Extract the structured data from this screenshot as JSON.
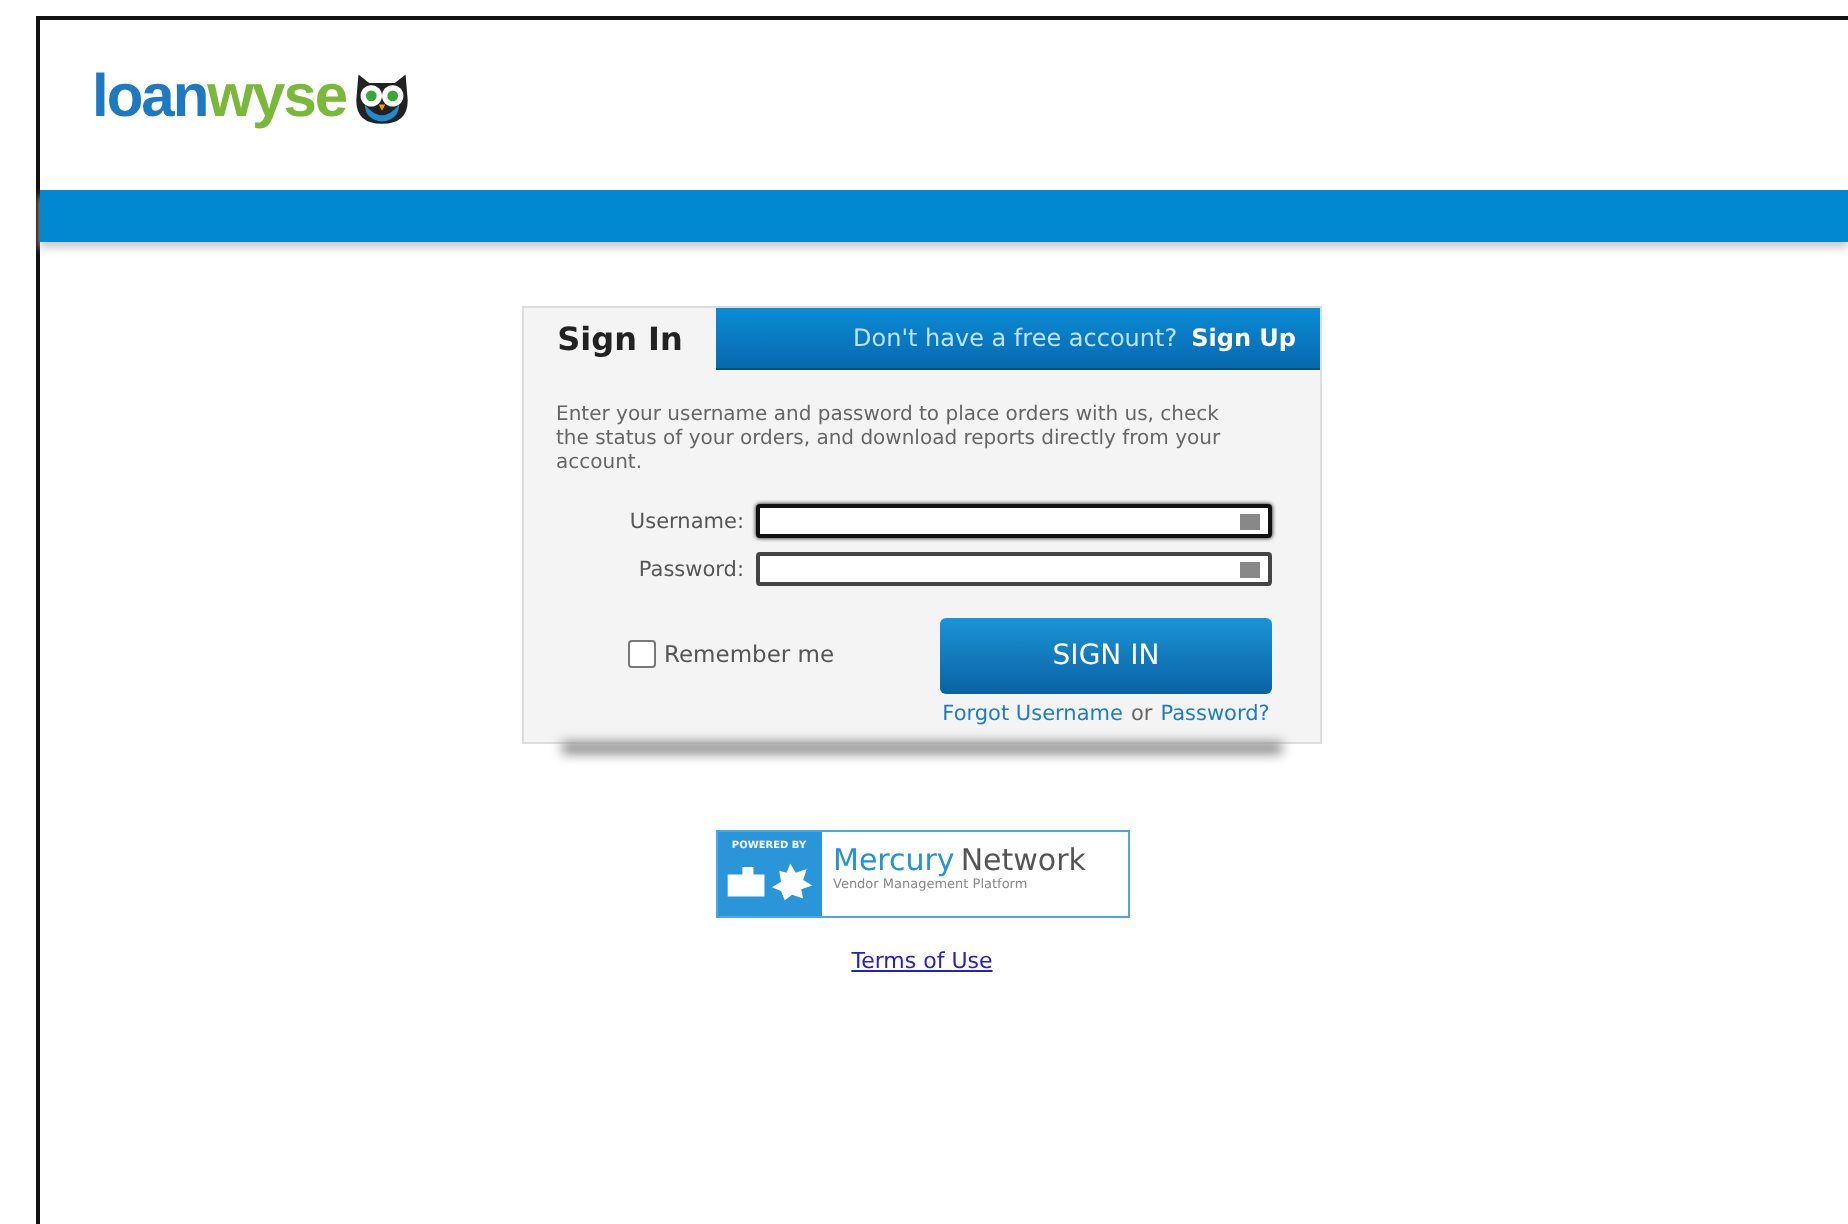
{
  "logo": {
    "first": "loan",
    "second": "wyse"
  },
  "signin": {
    "tabs": [
      {
        "label": "Sign In",
        "selected": true
      }
    ],
    "signup_prompt": "Don't have a free account?",
    "signup_link": "Sign Up",
    "intro": "Enter your username and password to place orders with us, check the status of your orders, and download reports directly from your account.",
    "fields": [
      {
        "label": "Username:",
        "focused": true
      },
      {
        "label": "Password:",
        "focused": false
      }
    ],
    "remember": {
      "label": "Remember me",
      "checked": false
    },
    "button": "SIGN IN",
    "forgot": {
      "first": "Forgot Username",
      "middle": "or",
      "second": "Password?"
    }
  },
  "badge": {
    "tag": "POWERED BY",
    "brand_first": "Mercury",
    "brand_second": "Network",
    "subtitle": "Vendor Management Platform"
  },
  "terms_link": "Terms of Use"
}
